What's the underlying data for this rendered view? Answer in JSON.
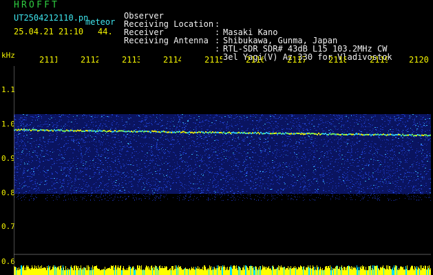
{
  "header": {
    "title": "HROFFT",
    "filename": "UT2504212110.pn",
    "meteor_label": "meteor",
    "datetime": "25.04.21 21:10",
    "count": "44."
  },
  "metadata": [
    {
      "key": "Observer",
      "value": "Masaki Kano"
    },
    {
      "key": "Receiving Location",
      "value": "Shibukawa, Gunma, Japan"
    },
    {
      "key": "Receiver",
      "value": "RTL-SDR SDR# 43dB L15 103.2MHz CW"
    },
    {
      "key": "Receiving Antenna",
      "value": "3el Yagi(V) Az 330 for Vladivostok"
    }
  ],
  "axis": {
    "unit": "kHz",
    "y_ticks": [
      "1.1",
      "1.0",
      "0.9",
      "0.8",
      "0.7",
      "0.6"
    ],
    "x_ticks": [
      "2111",
      "2112",
      "2113",
      "2114",
      "2115",
      "2116",
      "2117",
      "2118",
      "2119",
      "2120"
    ]
  },
  "colors": {
    "background": "#000000",
    "text_cyan": "#3ee6ee",
    "text_white": "#f2f2f2",
    "text_yellow": "#f4f400",
    "title_green": "#2ecc40",
    "noise_blue": "#1f3fd0",
    "trace_yellow": "#ffff00"
  }
}
